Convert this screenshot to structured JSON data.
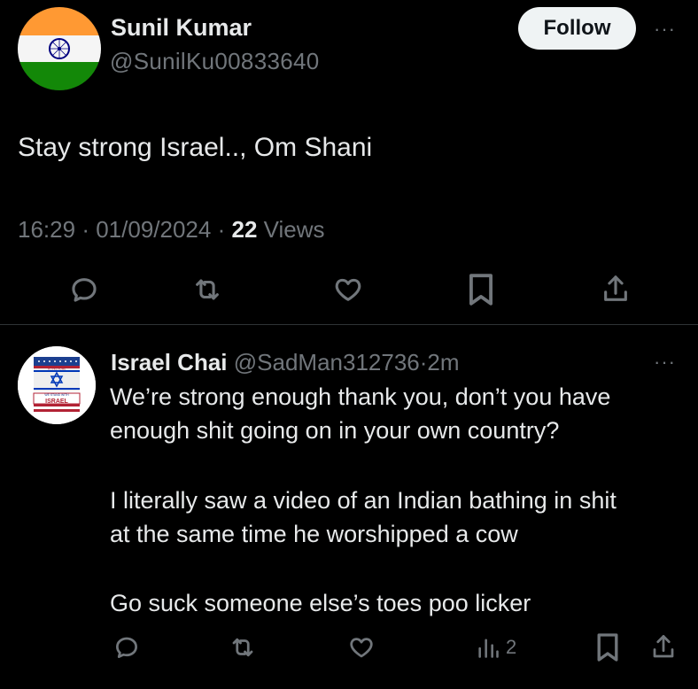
{
  "post": {
    "author_name": "Sunil Kumar",
    "author_handle": "@SunilKu00833640",
    "follow_label": "Follow",
    "more_label": "···",
    "text": "Stay strong Israel.., Om Shani",
    "time": "16:29",
    "date": "01/09/2024",
    "views_count": "22",
    "views_label": "Views",
    "separator": "·",
    "avatar": "india-flag-avatar"
  },
  "reply": {
    "author_name": "Israel Chai",
    "author_handle": "@SadMan312736",
    "age": "2m",
    "separator": "·",
    "more_label": "···",
    "avatar": "we-stand-with-israel-badge",
    "avatar_text_top": "IN THIS HOME",
    "avatar_text_mid": "WE STAND WITH",
    "avatar_text_bottom": "ISRAEL",
    "lines": [
      "We’re strong enough thank you, don’t you have",
      "enough shit going on in your own country?",
      "I literally saw a video of an Indian bathing in shit",
      "at the same time he worshipped a cow",
      "Go suck someone else’s toes poo licker"
    ],
    "analytics_count": "2"
  },
  "icons": [
    "reply-icon",
    "repost-icon",
    "like-icon",
    "bookmark-icon",
    "share-icon",
    "analytics-icon"
  ],
  "colors": {
    "background": "#000000",
    "text": "#e7e9ea",
    "muted": "#71767b",
    "divider": "#2f3336",
    "follow_bg": "#eff3f4",
    "saffron": "#ff9933",
    "green": "#138808",
    "chakra": "#000080",
    "israel_blue": "#0038b8"
  }
}
